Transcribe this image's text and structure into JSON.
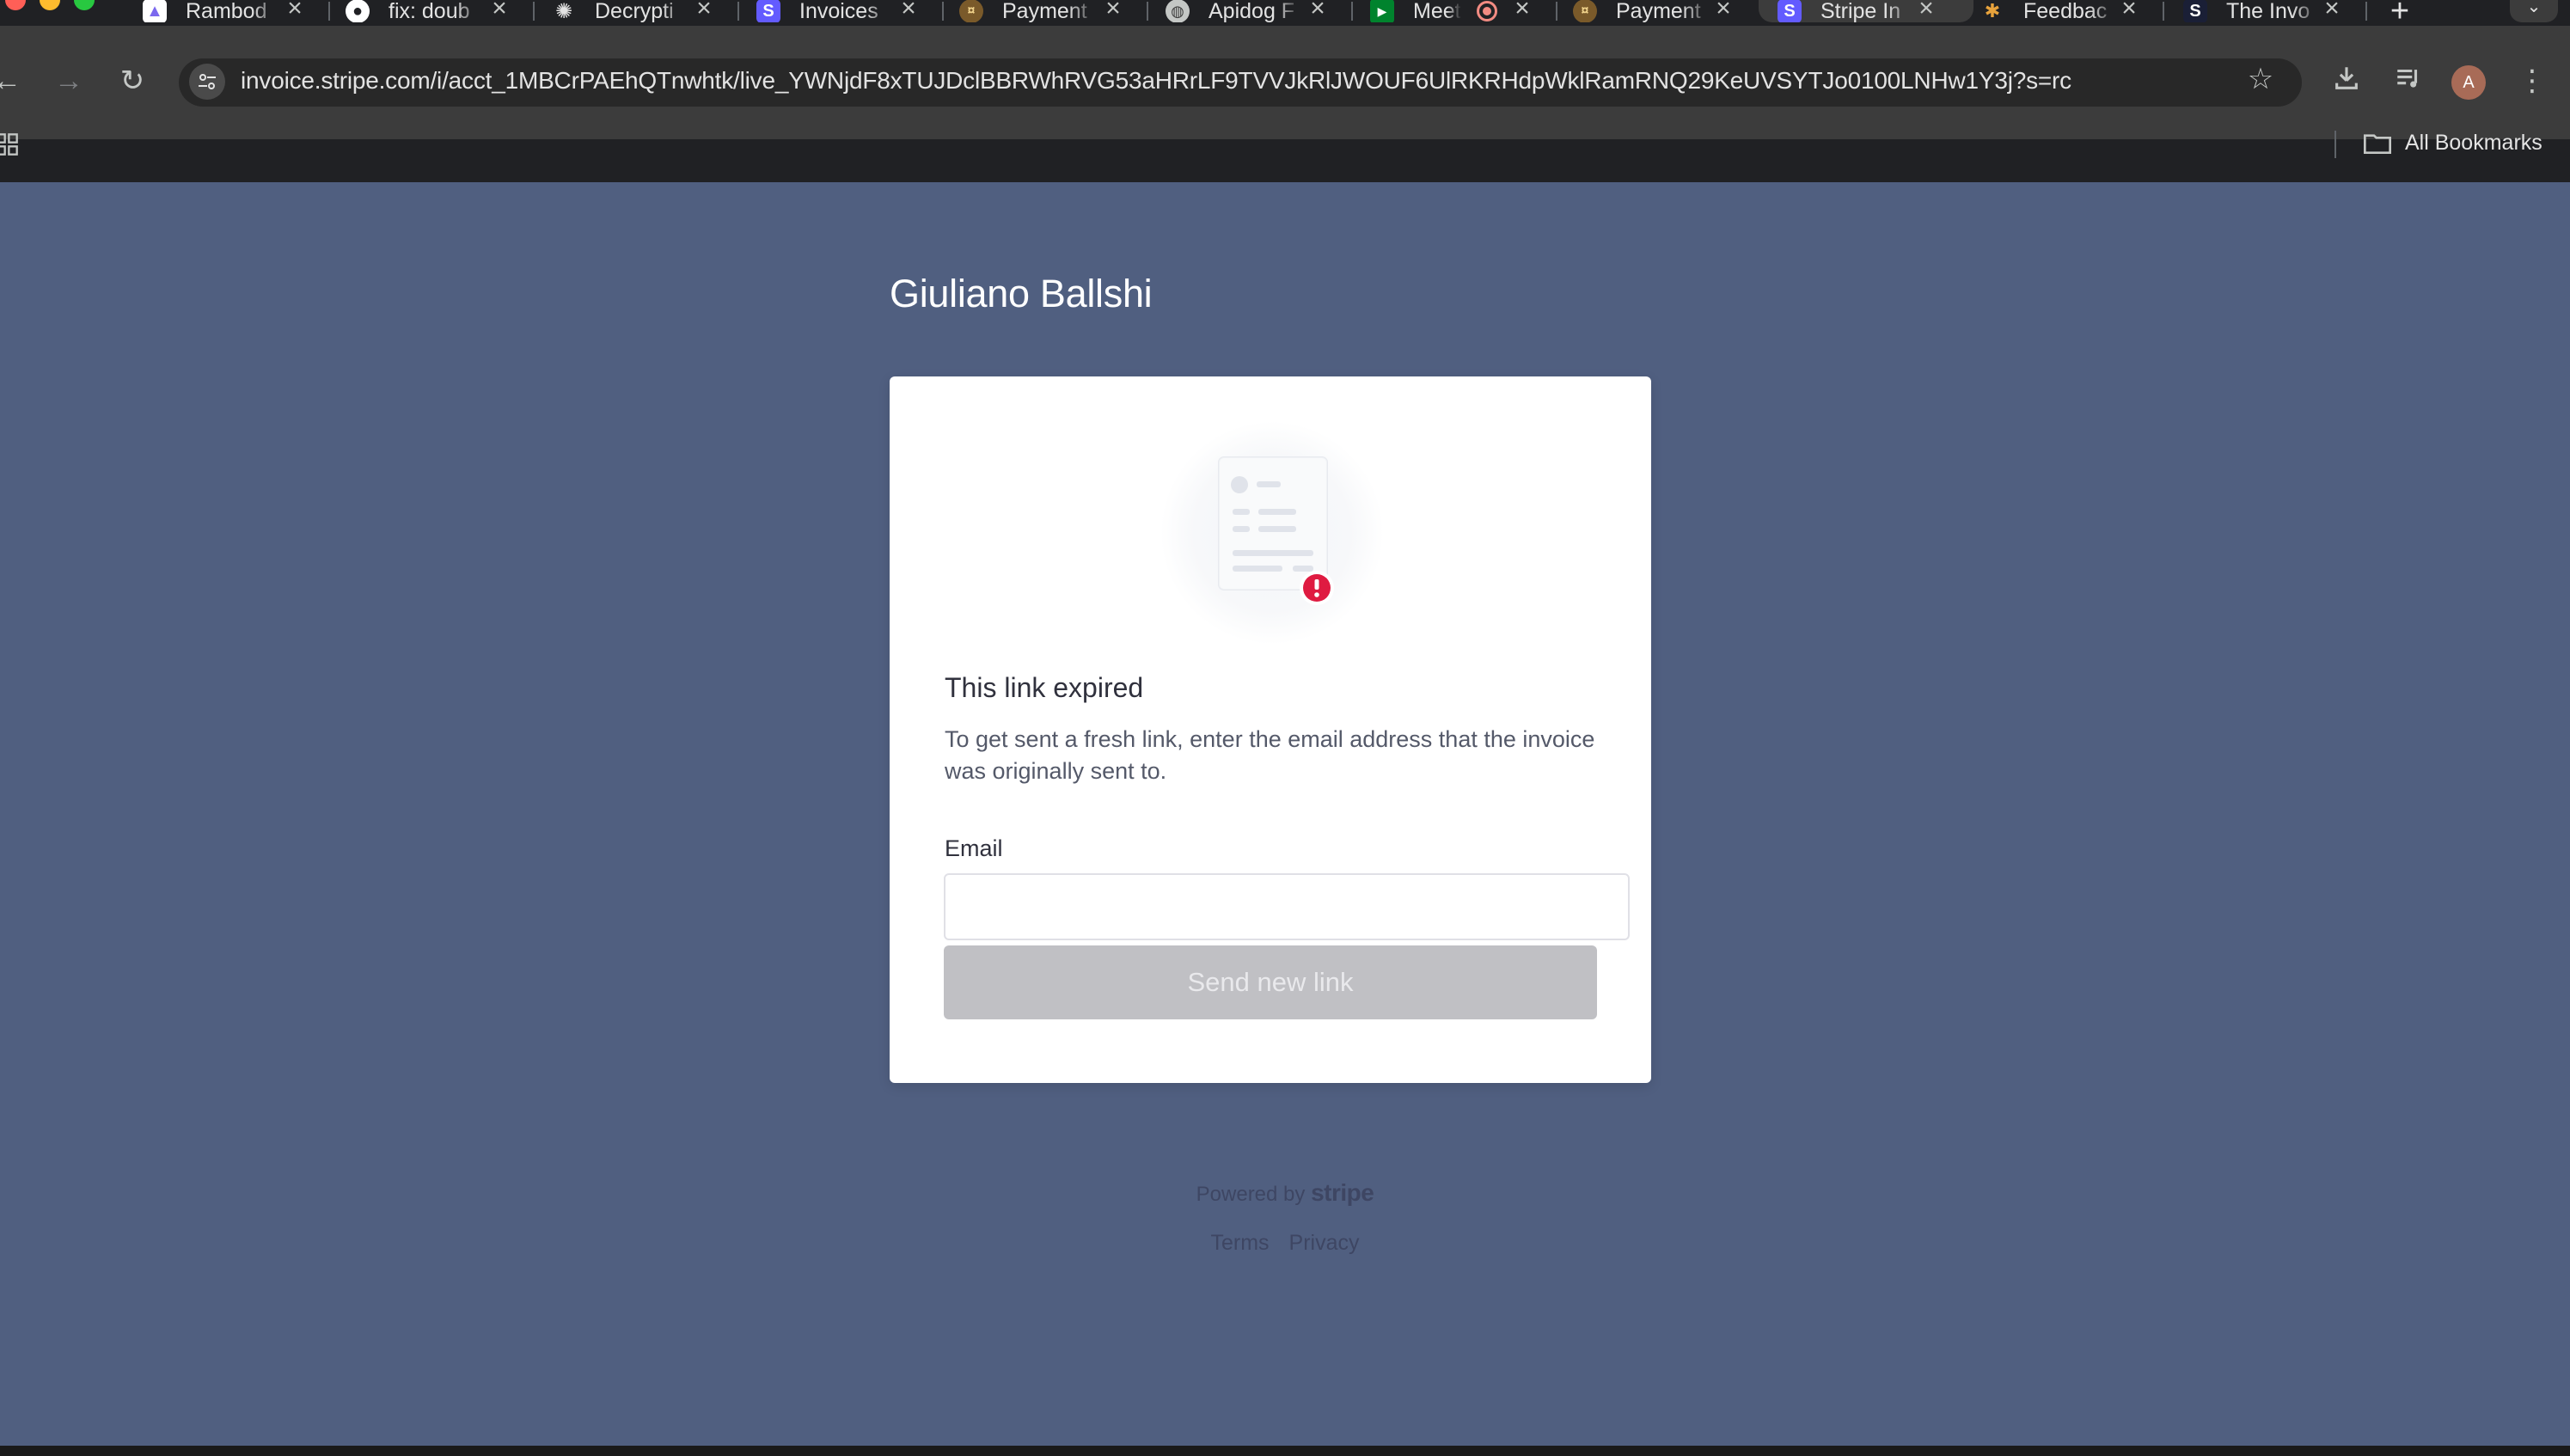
{
  "browser": {
    "tabs": [
      {
        "title": "Rambod",
        "icon": "clickup-icon"
      },
      {
        "title": "fix: doub",
        "icon": "github-icon"
      },
      {
        "title": "Decrypti",
        "icon": "openai-icon"
      },
      {
        "title": "Invoices",
        "icon": "stripe-icon"
      },
      {
        "title": "Payment",
        "icon": "payment-icon"
      },
      {
        "title": "Apidog F",
        "icon": "globe-icon"
      },
      {
        "title": "Meet",
        "icon": "meet-icon"
      },
      {
        "title": "Payment",
        "icon": "payment-icon"
      },
      {
        "title": "Stripe In",
        "icon": "stripe-icon",
        "active": true
      },
      {
        "title": "Feedbac",
        "icon": "feedback-icon"
      },
      {
        "title": "The Invo",
        "icon": "stripe-dark-icon"
      }
    ],
    "url": "invoice.stripe.com/i/acct_1MBCrPAEhQTnwhtk/live_YWNjdF8xTUJDclBBRWhRVG53aHRrLF9TVVJkRlJWOUF6UlRKRHdpWklRamRNQ29KeUVSYTJo0100LNHw1Y3j?s=rc",
    "profile_initial": "A",
    "bookmarks_label": "All Bookmarks"
  },
  "page": {
    "merchant_name": "Giuliano Ballshi",
    "card": {
      "heading": "This link expired",
      "body": "To get sent a fresh link, enter the email address that the invoice was originally sent to.",
      "email_label": "Email",
      "email_value": "",
      "button_label": "Send new link"
    },
    "footer": {
      "powered_by": "Powered by",
      "brand": "stripe",
      "terms": "Terms",
      "privacy": "Privacy"
    }
  },
  "colors": {
    "page_background": "#505f80",
    "button_disabled": "#c0c0c4",
    "alert_red": "#df1b41"
  }
}
